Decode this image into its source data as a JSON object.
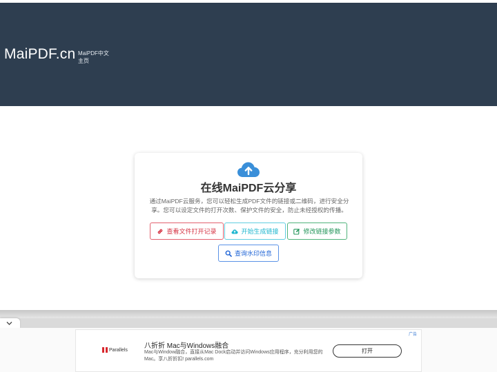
{
  "header": {
    "brand": "MaiPDF.cn",
    "nav": [
      "MaiPDF中文",
      "主页"
    ],
    "background": "#2e3e50"
  },
  "card": {
    "icon": "cloud-upload-icon",
    "title": "在线MaiPDF云分享",
    "description": "通过MaiPDF云服务，您可以轻松生成PDF文件的链接或二维码，进行安全分享。您可以设定文件的打开次数、保护文件的安全，防止未经授权的传播。",
    "buttons": {
      "records": "查看文件打开记录",
      "generate": "开始生成链接",
      "modify": "修改链接参数",
      "watermark": "查询水印信息"
    }
  },
  "ad": {
    "label": "广告",
    "logo": "Parallels",
    "title": "八折折 Mac与Windows融合",
    "text": "Mac与Window融合，直接从Mac Dock启动并访问Windows应用程序，充分利用您的Mac。享八折折扣! parallels.com",
    "button": "打开"
  },
  "colors": {
    "red": "#d63545",
    "cyan": "#1fb6cf",
    "green": "#23955a",
    "blue": "#1f64d6",
    "cloud": "#3a8fd9"
  }
}
